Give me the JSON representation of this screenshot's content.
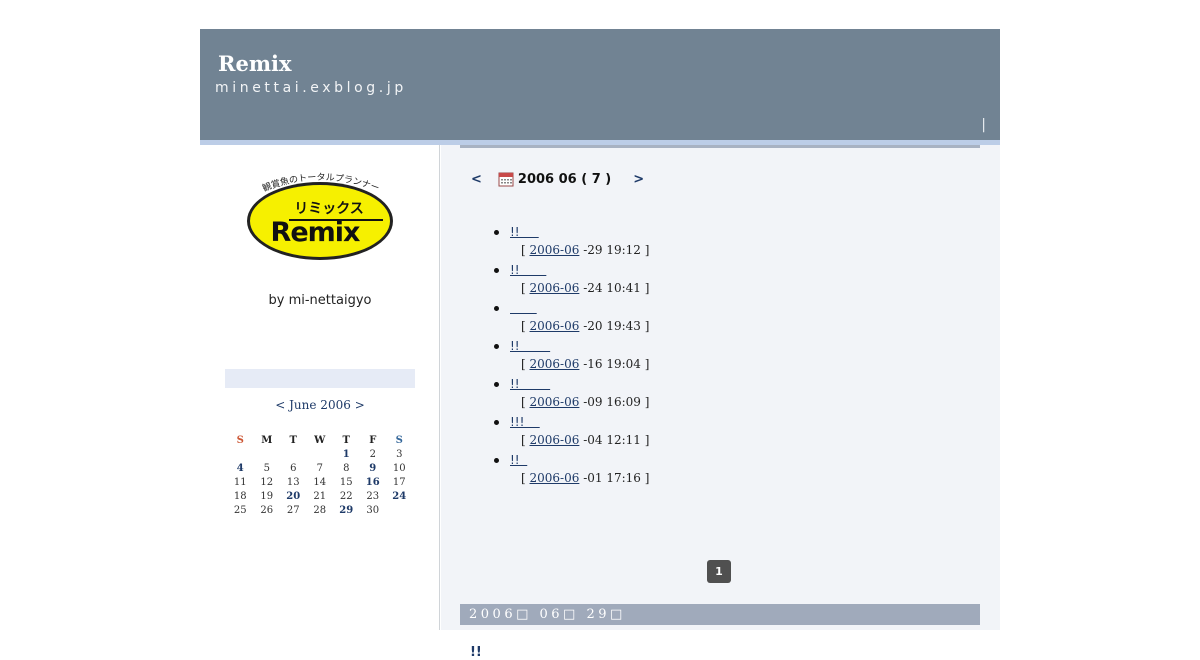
{
  "header": {
    "site_title": "Remix",
    "site_url": "minettai.exblog.jp",
    "separator": "|"
  },
  "sidebar": {
    "logo": {
      "top_text": "観賞魚のトータルプランナー",
      "katakana": "リミックス",
      "brand": "Remix",
      "bg_color": "#f6f000"
    },
    "byline": "by mi-nettaigyo",
    "calendar": {
      "prev": "<",
      "month_label": "June 2006",
      "next": ">",
      "weekdays": [
        "S",
        "M",
        "T",
        "W",
        "T",
        "F",
        "S"
      ],
      "weeks": [
        [
          "",
          "",
          "",
          "",
          "1",
          "2",
          "3"
        ],
        [
          "4",
          "5",
          "6",
          "7",
          "8",
          "9",
          "10"
        ],
        [
          "11",
          "12",
          "13",
          "14",
          "15",
          "16",
          "17"
        ],
        [
          "18",
          "19",
          "20",
          "21",
          "22",
          "23",
          "24"
        ],
        [
          "25",
          "26",
          "27",
          "28",
          "29",
          "30",
          ""
        ]
      ],
      "linked_days": [
        "1",
        "4",
        "9",
        "16",
        "20",
        "24",
        "29"
      ]
    }
  },
  "main": {
    "month_nav": {
      "prev": "<",
      "title": "2006 06 ( 7 )",
      "next": ">"
    },
    "entries": [
      {
        "title": "!!     ",
        "date_link": "2006-06",
        "time": " -29 19:12 ]"
      },
      {
        "title": "!!       ",
        "date_link": "2006-06",
        "time": " -24 10:41 ]"
      },
      {
        "title": "       ",
        "date_link": "2006-06",
        "time": " -20 19:43 ]"
      },
      {
        "title": "!!        ",
        "date_link": "2006-06",
        "time": " -16 19:04 ]"
      },
      {
        "title": "!!        ",
        "date_link": "2006-06",
        "time": " -09 16:09 ]"
      },
      {
        "title": "!!!    ",
        "date_link": "2006-06",
        "time": " -04 12:11 ]"
      },
      {
        "title": "!!  ",
        "date_link": "2006-06",
        "time": " -01 17:16 ]"
      }
    ],
    "meta_open": "[ ",
    "pager_current": "1",
    "date_header": "2006□ 06□ 29□",
    "post_title": "!!"
  },
  "colors": {
    "header_bg": "#718393",
    "header_bar": "#bccde7",
    "main_bg": "#f2f4f8",
    "link": "#1e3a68",
    "date_bar": "#a0aabb"
  }
}
